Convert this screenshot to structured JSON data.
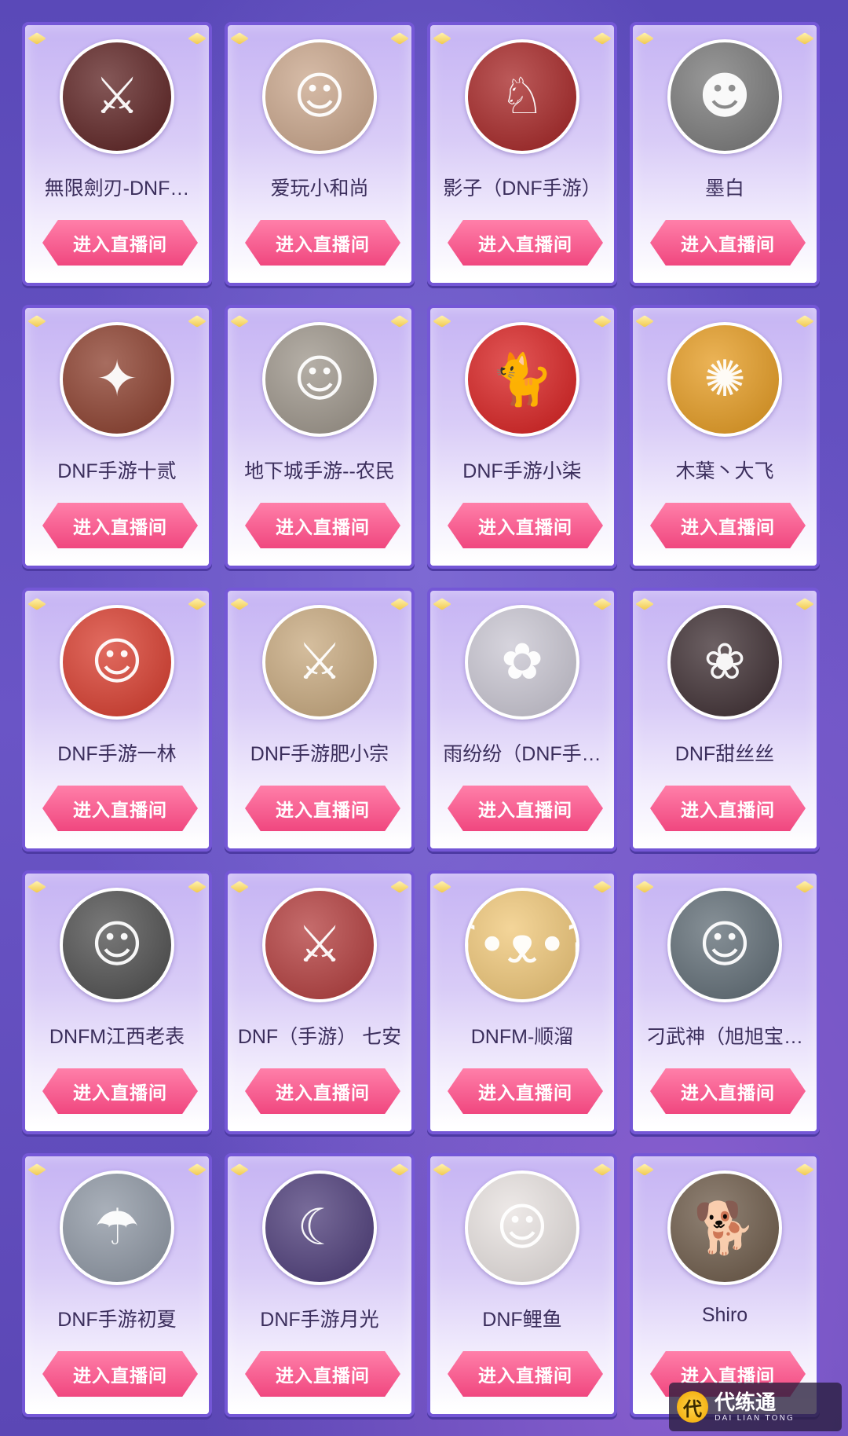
{
  "button_label": "进入直播间",
  "streamers": [
    {
      "name": "無限劍刃-DNF…",
      "avatar_icon": "warrior-avatar-icon",
      "avatar_color": "#5b1f1f",
      "glyph": "⚔"
    },
    {
      "name": "爱玩小和尚",
      "avatar_icon": "boy-avatar-icon",
      "avatar_color": "#c9a58a",
      "glyph": "☺"
    },
    {
      "name": "影子（DNF手游）",
      "avatar_icon": "wolf-girl-avatar-icon",
      "avatar_color": "#a52222",
      "glyph": "♘"
    },
    {
      "name": "墨白",
      "avatar_icon": "anime-boy-avatar-icon",
      "avatar_color": "#777777",
      "glyph": "☻"
    },
    {
      "name": "DNF手游十贰",
      "avatar_icon": "anime-fighter-avatar-icon",
      "avatar_color": "#8a3c2a",
      "glyph": "✦"
    },
    {
      "name": "地下城手游--农民",
      "avatar_icon": "anime-girl-avatar-icon",
      "avatar_color": "#9c9489",
      "glyph": "☺"
    },
    {
      "name": "DNF手游小柒",
      "avatar_icon": "black-cat-avatar-icon",
      "avatar_color": "#d81d1d",
      "glyph": "🐈"
    },
    {
      "name": "木葉丶大飞",
      "avatar_icon": "ninja-avatar-icon",
      "avatar_color": "#e59a1e",
      "glyph": "✺"
    },
    {
      "name": "DNF手游一林",
      "avatar_icon": "pirate-avatar-icon",
      "avatar_color": "#d83a2b",
      "glyph": "☺"
    },
    {
      "name": "DNF手游肥小宗",
      "avatar_icon": "swordswoman-avatar-icon",
      "avatar_color": "#c7a87d",
      "glyph": "⚔"
    },
    {
      "name": "雨纷纷（DNF手…",
      "avatar_icon": "anime-fox-avatar-icon",
      "avatar_color": "#c9c6d2",
      "glyph": "✿"
    },
    {
      "name": "DNF甜丝丝",
      "avatar_icon": "woman-avatar-icon",
      "avatar_color": "#3b2b2f",
      "glyph": "❀"
    },
    {
      "name": "DNFM江西老表",
      "avatar_icon": "man-portrait-avatar-icon",
      "avatar_color": "#4c4c4c",
      "glyph": "☺"
    },
    {
      "name": "DNF（手游） 七安",
      "avatar_icon": "red-warrior-avatar-icon",
      "avatar_color": "#b23a3a",
      "glyph": "⚔"
    },
    {
      "name": "DNFM-顺溜",
      "avatar_icon": "bear-avatar-icon",
      "avatar_color": "#f0c777",
      "glyph": "ʕ•ᴥ•ʔ"
    },
    {
      "name": "刁武神（旭旭宝…",
      "avatar_icon": "sunglasses-man-avatar-icon",
      "avatar_color": "#5e6b74",
      "glyph": "☺"
    },
    {
      "name": "DNF手游初夏",
      "avatar_icon": "rain-boy-avatar-icon",
      "avatar_color": "#8d96a3",
      "glyph": "☂"
    },
    {
      "name": "DNF手游月光",
      "avatar_icon": "dark-knight-avatar-icon",
      "avatar_color": "#4b3a78",
      "glyph": "☾"
    },
    {
      "name": "DNF鲤鱼",
      "avatar_icon": "cartoon-boy-avatar-icon",
      "avatar_color": "#e8e2e0",
      "glyph": "☺"
    },
    {
      "name": "Shiro",
      "avatar_icon": "puppy-avatar-icon",
      "avatar_color": "#6b5846",
      "glyph": "🐕"
    }
  ],
  "watermark": {
    "logo": "代",
    "title": "代练通",
    "subtitle": "DAI LIAN TONG"
  }
}
